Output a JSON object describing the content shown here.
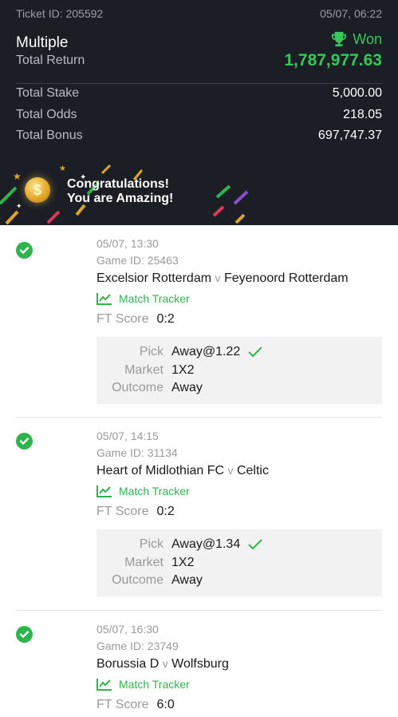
{
  "header": {
    "ticket_id": "Ticket ID: 205592",
    "time": "05/07, 06:22",
    "bet_type": "Multiple",
    "status": "Won",
    "status_icon": "trophy-icon",
    "total_return_label": "Total Return",
    "total_return_value": "1,787,977.63",
    "total_stake_label": "Total Stake",
    "total_stake_value": "5,000.00",
    "total_odds_label": "Total Odds",
    "total_odds_value": "218.05",
    "total_bonus_label": "Total Bonus",
    "total_bonus_value": "697,747.37",
    "congrats_line1": "Congratulations!",
    "congrats_line2": "You are Amazing!",
    "coin_symbol": "$",
    "colors": {
      "background": "#1b1e25",
      "accent_green": "#35c85a"
    }
  },
  "matches": [
    {
      "time": "05/07, 13:30",
      "game_id": "Game ID: 25463",
      "home": "Excelsior Rotterdam",
      "vs": "v",
      "away": "Feyenoord Rotterdam",
      "tracker": "Match Tracker",
      "ft_label": "FT Score",
      "ft_score": "0:2",
      "pick_label": "Pick",
      "pick_value": "Away@1.22",
      "market_label": "Market",
      "market_value": "1X2",
      "outcome_label": "Outcome",
      "outcome_value": "Away"
    },
    {
      "time": "05/07, 14:15",
      "game_id": "Game ID: 31134",
      "home": "Heart of Midlothian FC",
      "vs": "v",
      "away": "Celtic",
      "tracker": "Match Tracker",
      "ft_label": "FT Score",
      "ft_score": "0:2",
      "pick_label": "Pick",
      "pick_value": "Away@1.34",
      "market_label": "Market",
      "market_value": "1X2",
      "outcome_label": "Outcome",
      "outcome_value": "Away"
    },
    {
      "time": "05/07, 16:30",
      "game_id": "Game ID: 23749",
      "home": "Borussia D",
      "vs": "v",
      "away": "Wolfsburg",
      "tracker": "Match Tracker",
      "ft_label": "FT Score",
      "ft_score": "6:0"
    }
  ]
}
